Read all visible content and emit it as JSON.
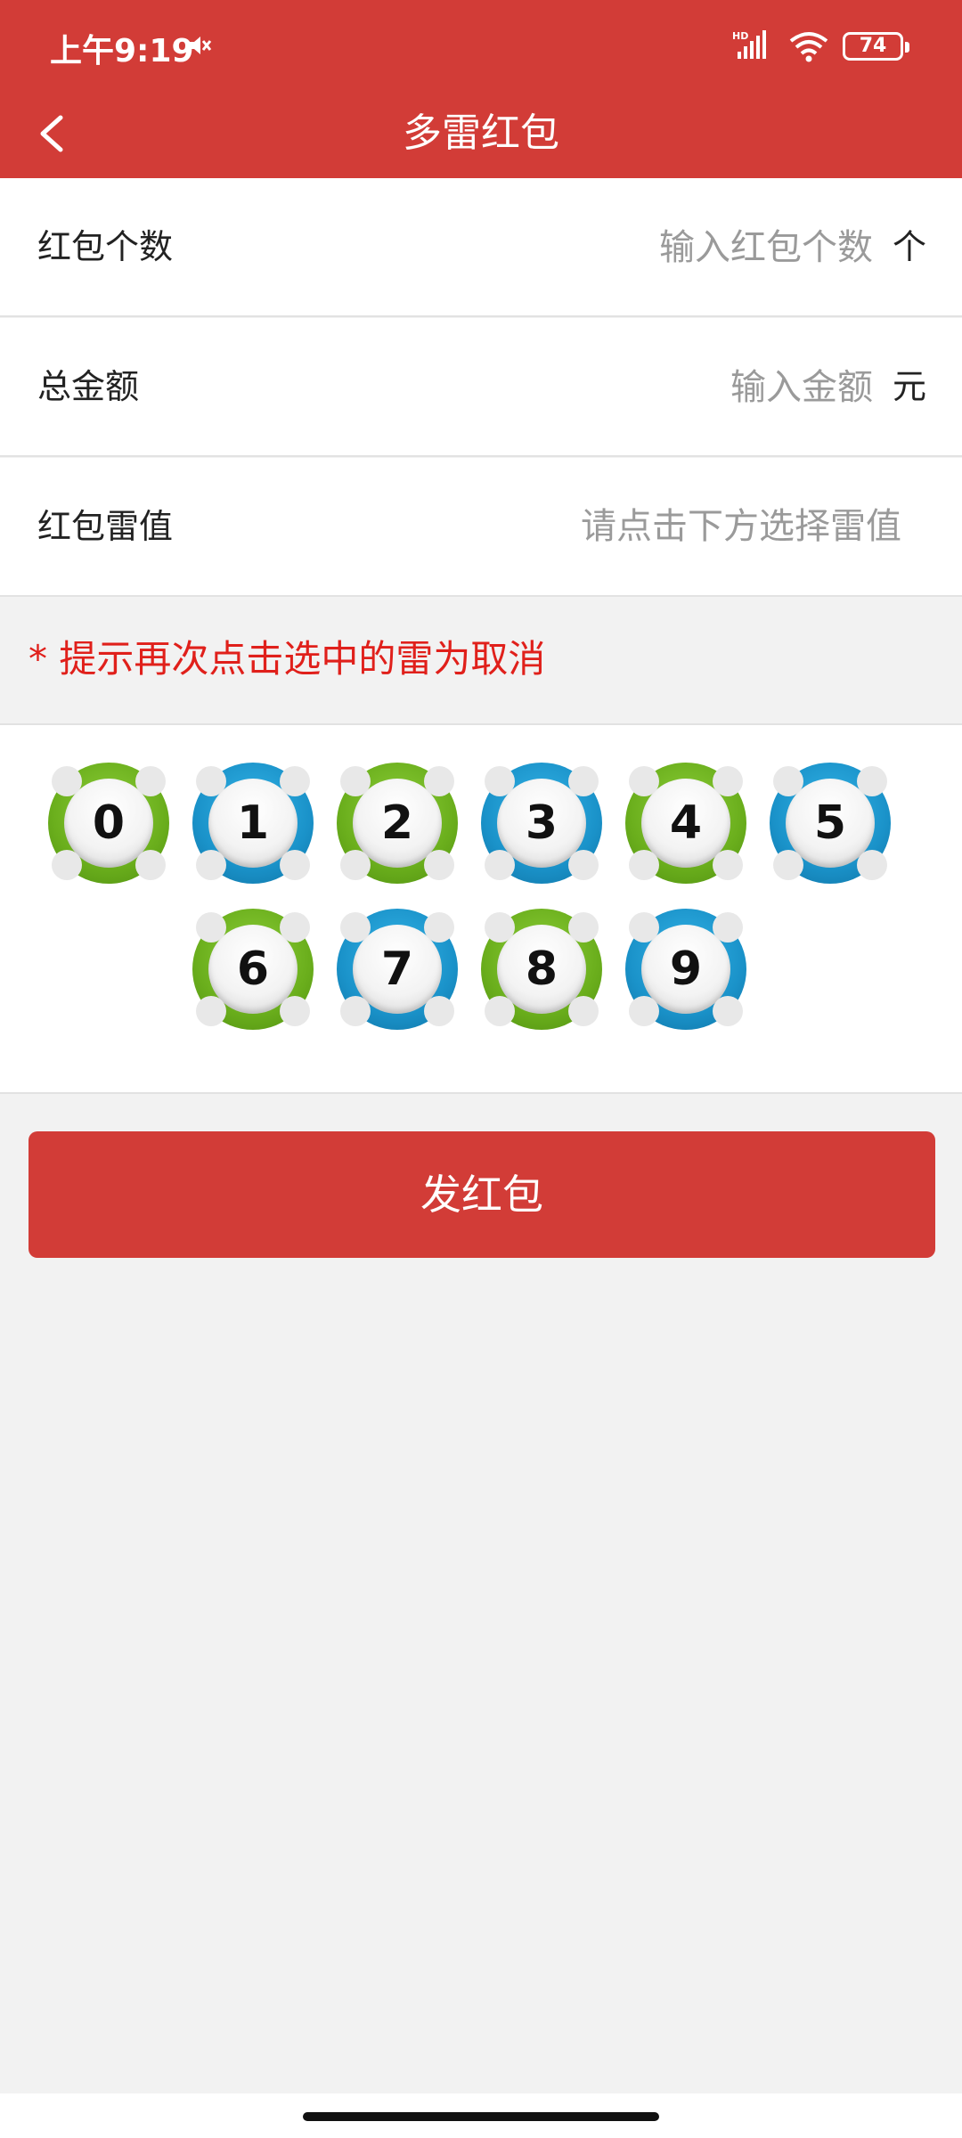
{
  "status_bar": {
    "time": "上午9:19",
    "battery": "74"
  },
  "header": {
    "title": "多雷红包"
  },
  "form": {
    "count": {
      "label": "红包个数",
      "placeholder": "输入红包个数",
      "unit": "个"
    },
    "amount": {
      "label": "总金额",
      "placeholder": "输入金额",
      "unit": "元"
    },
    "mine": {
      "label": "红包雷值",
      "hint": "请点击下方选择雷值"
    }
  },
  "tip": "* 提示再次点击选中的雷为取消",
  "balls": [
    {
      "num": "0",
      "color": "green"
    },
    {
      "num": "1",
      "color": "blue"
    },
    {
      "num": "2",
      "color": "green"
    },
    {
      "num": "3",
      "color": "blue"
    },
    {
      "num": "4",
      "color": "green"
    },
    {
      "num": "5",
      "color": "blue"
    },
    {
      "num": "6",
      "color": "green"
    },
    {
      "num": "7",
      "color": "blue"
    },
    {
      "num": "8",
      "color": "green"
    },
    {
      "num": "9",
      "color": "blue"
    }
  ],
  "send_button": "发红包",
  "colors": {
    "primary_red": "#d23c37",
    "tip_red": "#e0201b",
    "ball_green": "#6aae1c",
    "ball_blue": "#1a92c9"
  }
}
